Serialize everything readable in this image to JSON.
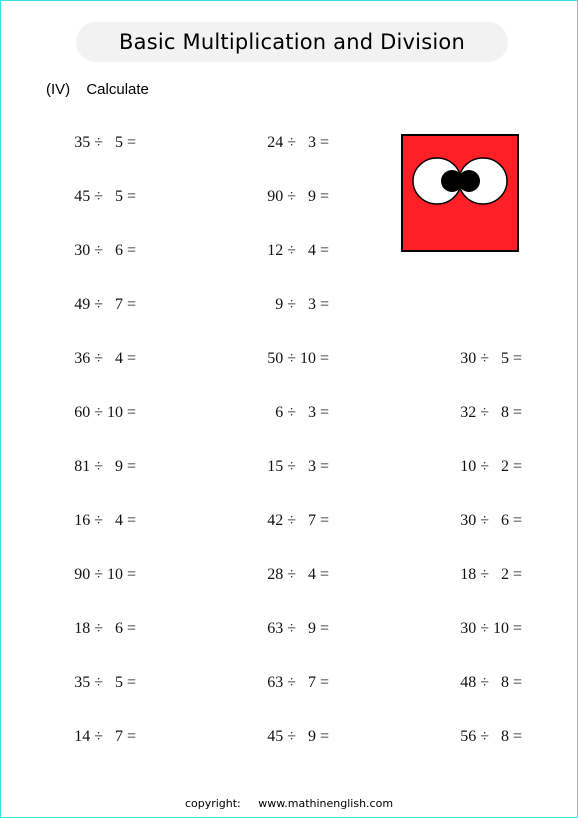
{
  "title": "Basic Multiplication and Division",
  "section": {
    "number": "(IV)",
    "instruction": "Calculate"
  },
  "columns": [
    {
      "problems": [
        "35 ÷   5 =",
        "45 ÷   5 =",
        "30 ÷   6 =",
        "49 ÷   7 =",
        "36 ÷   4 =",
        "60 ÷ 10 =",
        "81 ÷   9 =",
        "16 ÷   4 =",
        "90 ÷ 10 =",
        "18 ÷   6 =",
        "35 ÷   5 =",
        "14 ÷   7 ="
      ]
    },
    {
      "problems": [
        "24 ÷   3 =",
        "90 ÷   9 =",
        "12 ÷   4 =",
        "9 ÷   3 =",
        "50 ÷ 10 =",
        "6 ÷   3 =",
        "15 ÷   3 =",
        "42 ÷   7 =",
        "28 ÷   4 =",
        "63 ÷   9 =",
        "63 ÷   7 =",
        "45 ÷   9 ="
      ]
    },
    {
      "problems": [
        null,
        null,
        null,
        null,
        "30 ÷   5 =",
        "32 ÷   8 =",
        "10 ÷   2 =",
        "30 ÷   6 =",
        "18 ÷   2 =",
        "30 ÷ 10 =",
        "48 ÷   8 =",
        "56 ÷   8 ="
      ]
    }
  ],
  "mascot": {
    "icon": "red-square-googly-eyes-icon",
    "color": "#ff1f26"
  },
  "footer": {
    "label": "copyright:",
    "site": "www.mathinenglish.com"
  }
}
